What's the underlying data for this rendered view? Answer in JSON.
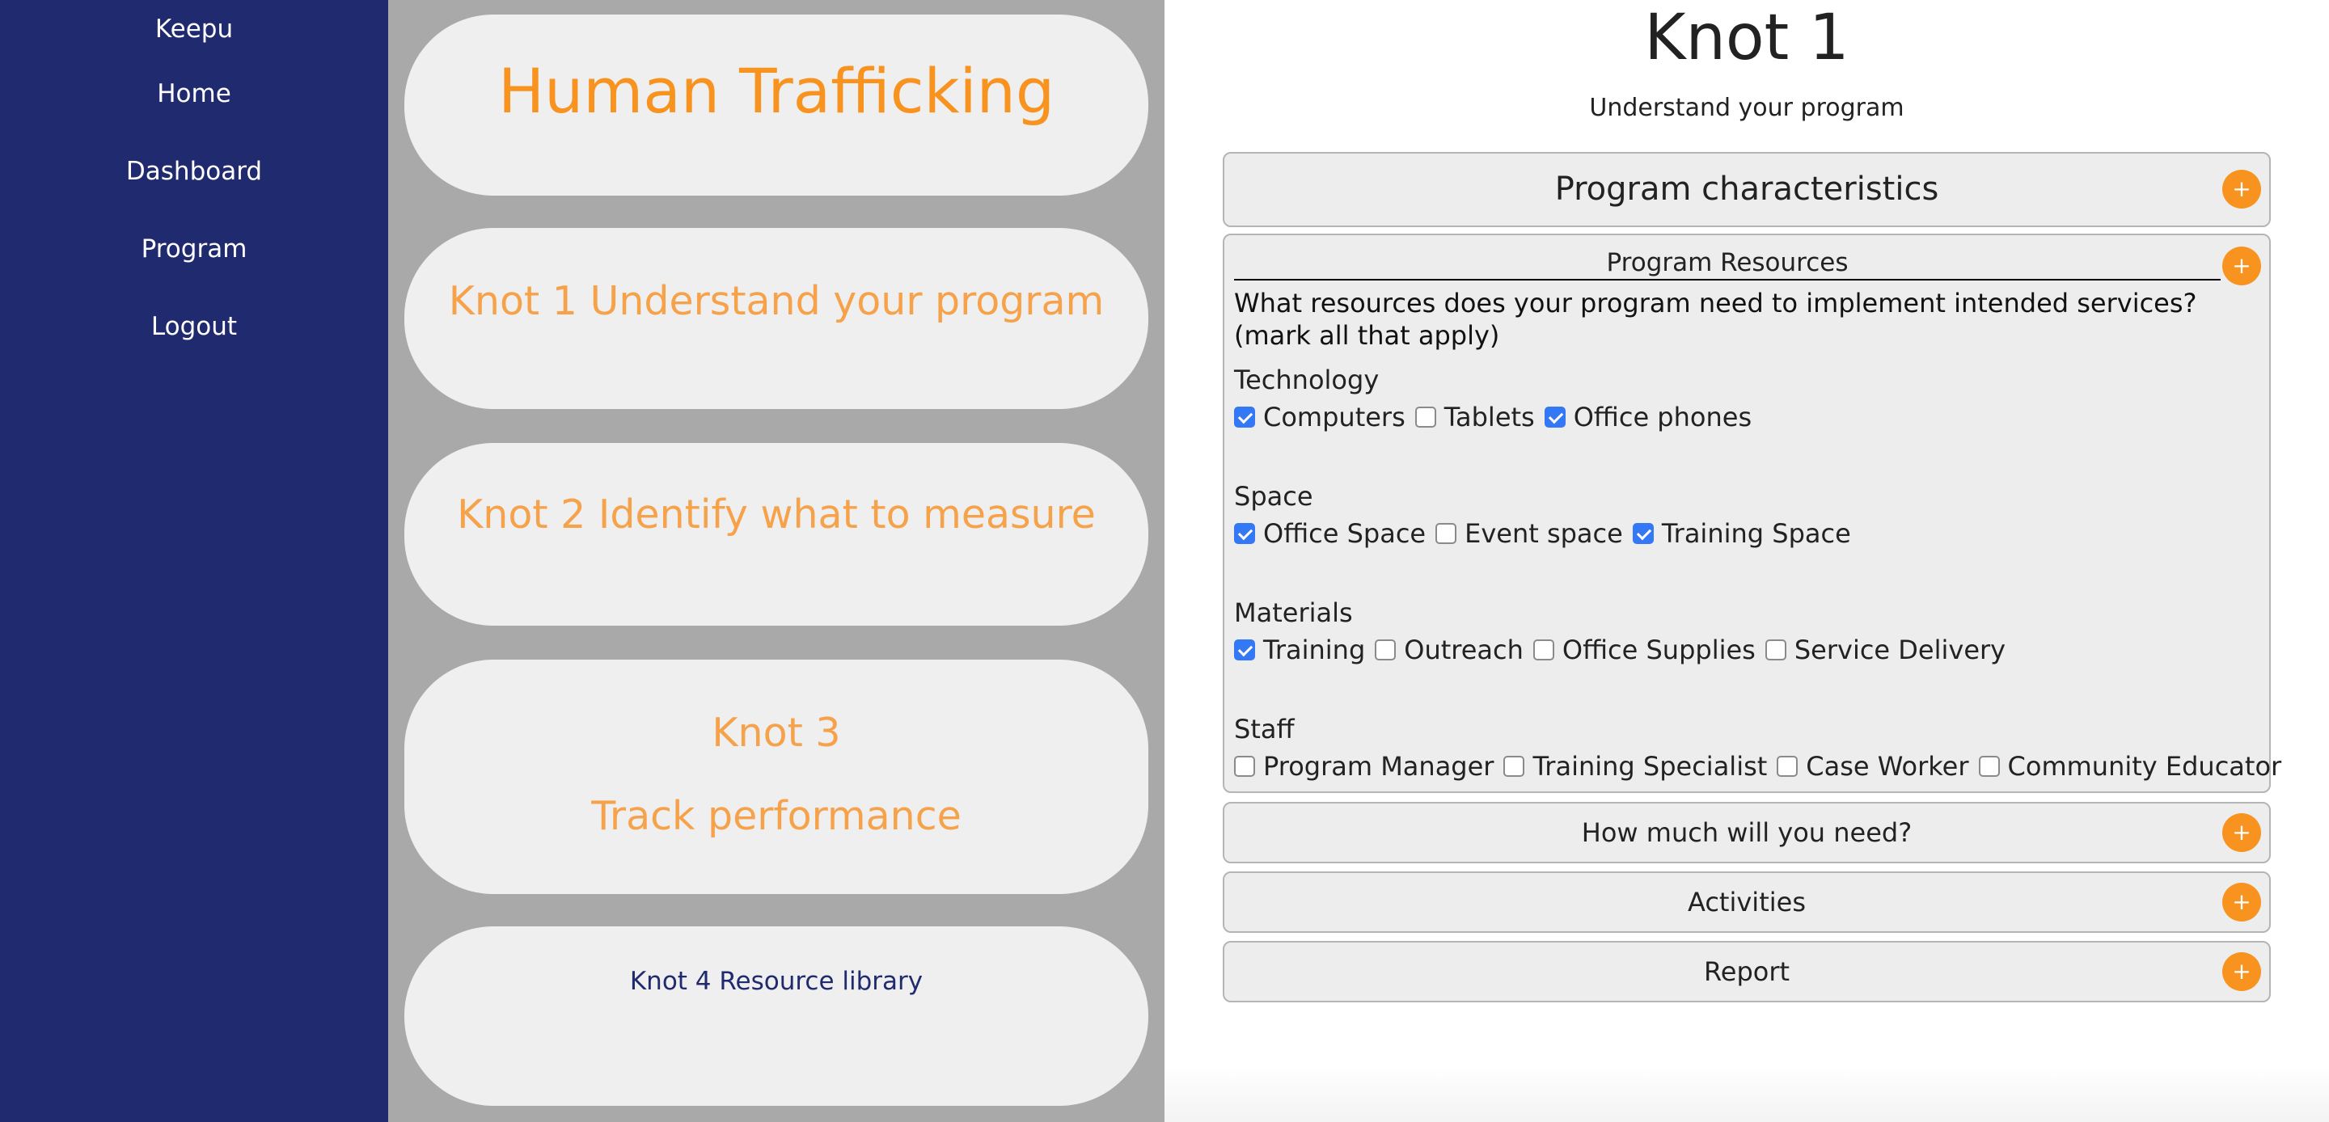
{
  "sidebar": {
    "brand": "Keepu",
    "items": [
      {
        "label": "Home"
      },
      {
        "label": "Dashboard"
      },
      {
        "label": "Program"
      },
      {
        "label": "Logout"
      }
    ]
  },
  "middle": {
    "title": "Human Trafficking",
    "knot1": "Knot 1 Understand your program",
    "knot2": "Knot 2 Identify what to measure",
    "knot3_line1": "Knot 3",
    "knot3_line2": "Track performance",
    "knot4": "Knot 4 Resource library"
  },
  "main": {
    "title": "Knot 1",
    "subtitle": "Understand your program",
    "plus": "+",
    "characteristics": {
      "label": "Program characteristics"
    },
    "resources": {
      "label": "Program Resources",
      "question": "What resources does your program need to implement intended services? (mark all that apply)",
      "categories": [
        {
          "label": "Technology",
          "options": [
            {
              "label": "Computers",
              "checked": true
            },
            {
              "label": "Tablets",
              "checked": false
            },
            {
              "label": "Office phones",
              "checked": true
            }
          ]
        },
        {
          "label": "Space",
          "options": [
            {
              "label": "Office Space",
              "checked": true
            },
            {
              "label": "Event space",
              "checked": false
            },
            {
              "label": "Training Space",
              "checked": true
            }
          ]
        },
        {
          "label": "Materials",
          "options": [
            {
              "label": "Training",
              "checked": true
            },
            {
              "label": "Outreach",
              "checked": false
            },
            {
              "label": "Office Supplies",
              "checked": false
            },
            {
              "label": "Service Delivery",
              "checked": false
            }
          ]
        },
        {
          "label": "Staff",
          "options": [
            {
              "label": "Program Manager",
              "checked": false
            },
            {
              "label": "Training Specialist",
              "checked": false
            },
            {
              "label": "Case Worker",
              "checked": false
            },
            {
              "label": "Community Educator",
              "checked": false
            }
          ]
        }
      ]
    },
    "how_much": {
      "label": "How much will you need?"
    },
    "activities": {
      "label": "Activities"
    },
    "report": {
      "label": "Report"
    }
  },
  "colors": {
    "sidebar": "#202a6e",
    "accent": "#f7931e",
    "checkbox": "#3478f6",
    "middle_bg": "#a9a9a9"
  }
}
